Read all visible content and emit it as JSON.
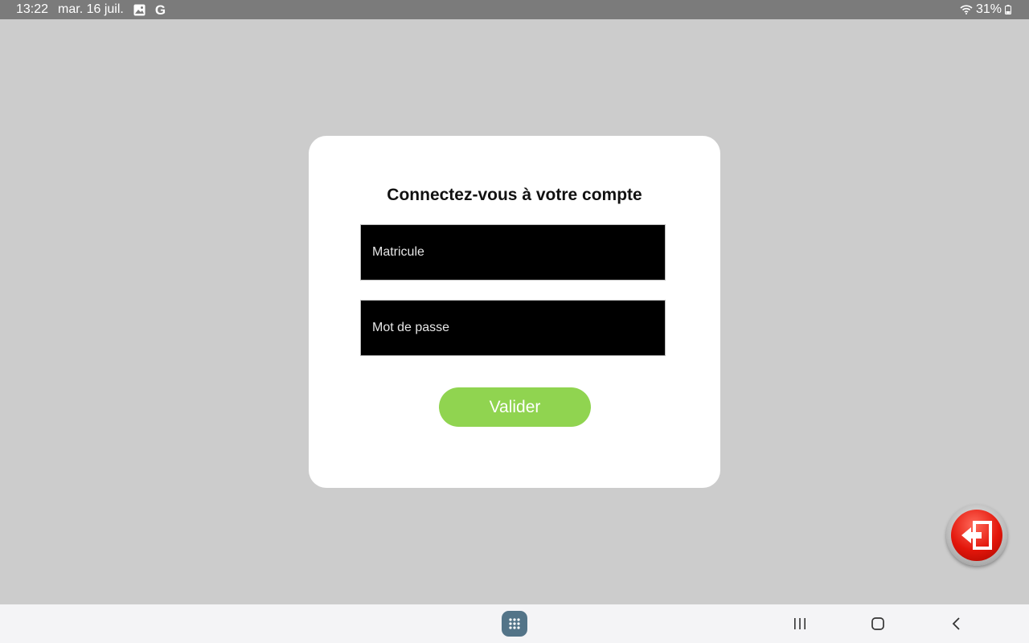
{
  "status_bar": {
    "time": "13:22",
    "date": "mar. 16 juil.",
    "icons": [
      "gallery-icon",
      "google-icon"
    ],
    "google_letter": "G",
    "battery": "31%"
  },
  "login": {
    "title": "Connectez-vous à votre compte",
    "matricule_placeholder": "Matricule",
    "matricule_value": "",
    "password_placeholder": "Mot de passe",
    "password_value": "",
    "submit_label": "Valider"
  },
  "floating": {
    "exit_icon": "exit-icon"
  },
  "nav_bar": {
    "items": [
      "apps-icon",
      "recents-icon",
      "home-icon",
      "back-icon"
    ]
  },
  "colors": {
    "background": "#cccccc",
    "status_bar": "#7b7b7b",
    "card": "#ffffff",
    "field": "#000000",
    "submit": "#90d450",
    "exit_button": "#e3160b",
    "apps_button": "#537488",
    "nav_bar": "#f4f4f6"
  }
}
